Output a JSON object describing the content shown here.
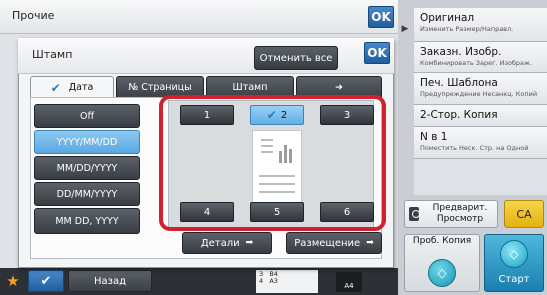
{
  "background": {
    "title": "Прочие",
    "ok_label": "OK"
  },
  "right_panel": {
    "items": [
      {
        "label": "Оригинал",
        "sub": "Изменить Размер/Направл."
      },
      {
        "label": "Заказн. Изобр.",
        "sub": "Комбинировать Зарег. Изображ."
      },
      {
        "label": "Печ. Шаблона",
        "sub": "Предупреждение Несанкц. Копий"
      },
      {
        "label": "2-Стор. Копия",
        "sub": ""
      },
      {
        "label": "N в 1",
        "sub": "Поместить Неск. Стр. на Одной"
      }
    ],
    "preview_label": "Предварит. Просмотр",
    "ca_label": "CA",
    "probe_label": "Проб. Копия",
    "start_label": "Старт"
  },
  "bottom_bar": {
    "back_label": "Назад",
    "paper_rows": [
      "3   B4",
      "4   A3"
    ],
    "paper_size": "A4"
  },
  "dialog": {
    "title": "Штамп",
    "cancel_all_label": "Отменить все",
    "ok_label": "OK",
    "tabs": [
      {
        "label": "Дата",
        "active": true
      },
      {
        "label": "№ Страницы",
        "active": false
      },
      {
        "label": "Штамп",
        "active": false
      },
      {
        "label": "➜",
        "active": false
      }
    ],
    "formats": [
      {
        "label": "Off",
        "selected": false
      },
      {
        "label": "YYYY/MM/DD",
        "selected": true
      },
      {
        "label": "MM/DD/YYYY",
        "selected": false
      },
      {
        "label": "DD/MM/YYYY",
        "selected": false
      },
      {
        "label": "MM DD, YYYY",
        "selected": false
      }
    ],
    "positions": [
      "1",
      "2",
      "3",
      "4",
      "5",
      "6"
    ],
    "selected_position": "2",
    "detail_label": "Детали",
    "placement_label": "Размещение"
  },
  "colors": {
    "accent_blue": "#2f7dc1",
    "selected_light_blue": "#62afe4",
    "highlight_red": "#d1202f",
    "ca_yellow": "#e3b20f",
    "start_cyan": "#1a7fb0"
  }
}
